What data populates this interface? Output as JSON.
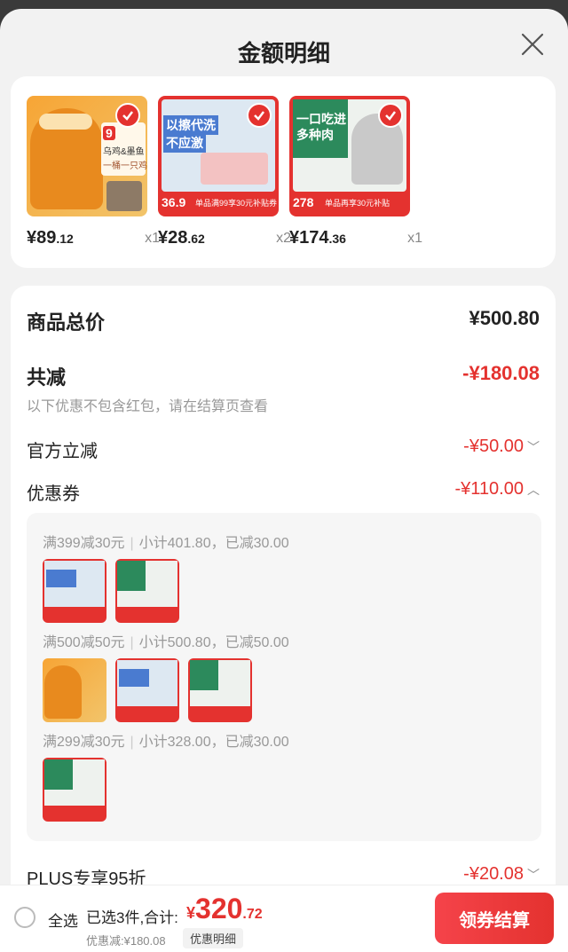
{
  "title": "金额明细",
  "products": [
    {
      "price_int": "¥89",
      "price_dec": ".12",
      "qty": "x1",
      "image": "orange-can-product",
      "image_text": [
        "乌鸡&墨鱼",
        "一桶一只鸡",
        "9"
      ]
    },
    {
      "price_int": "¥28",
      "price_dec": ".62",
      "qty": "x2",
      "image": "red-wipes-product",
      "image_text": [
        "以擦代洗",
        "不应激",
        "36.9",
        "单品满99享30元补贴券"
      ]
    },
    {
      "price_int": "¥174",
      "price_dec": ".36",
      "qty": "x1",
      "image": "red-catfood-product",
      "image_text": [
        "一口吃进",
        "多种肉",
        "278",
        "单品再享30元补贴"
      ]
    }
  ],
  "summary": {
    "total_label": "商品总价",
    "total_value": "¥500.80",
    "reduce_label": "共减",
    "reduce_value": "-¥180.08",
    "note": "以下优惠不包含红包，请在结算页查看",
    "official_label": "官方立减",
    "official_value": "-¥50.00",
    "coupon_label": "优惠券",
    "coupon_value": "-¥110.00",
    "plus_label": "PLUS专享95折",
    "plus_value": "-¥20.08"
  },
  "coupons": [
    {
      "rule": "满399减30元",
      "detail": "小计401.80，已减30.00"
    },
    {
      "rule": "满500减50元",
      "detail": "小计500.80，已减50.00"
    },
    {
      "rule": "满299减30元",
      "detail": "小计328.00，已减30.00"
    }
  ],
  "bottom": {
    "select_all": "全选",
    "selected": "已选3件,合计:",
    "currency": "¥",
    "total_int": "320",
    "total_dec": ".72",
    "discount_note": "优惠减:¥180.08",
    "detail_btn": "优惠明细",
    "checkout": "领券结算"
  },
  "colors": {
    "accent": "#e4322f",
    "bg": "#f2f2f2"
  }
}
